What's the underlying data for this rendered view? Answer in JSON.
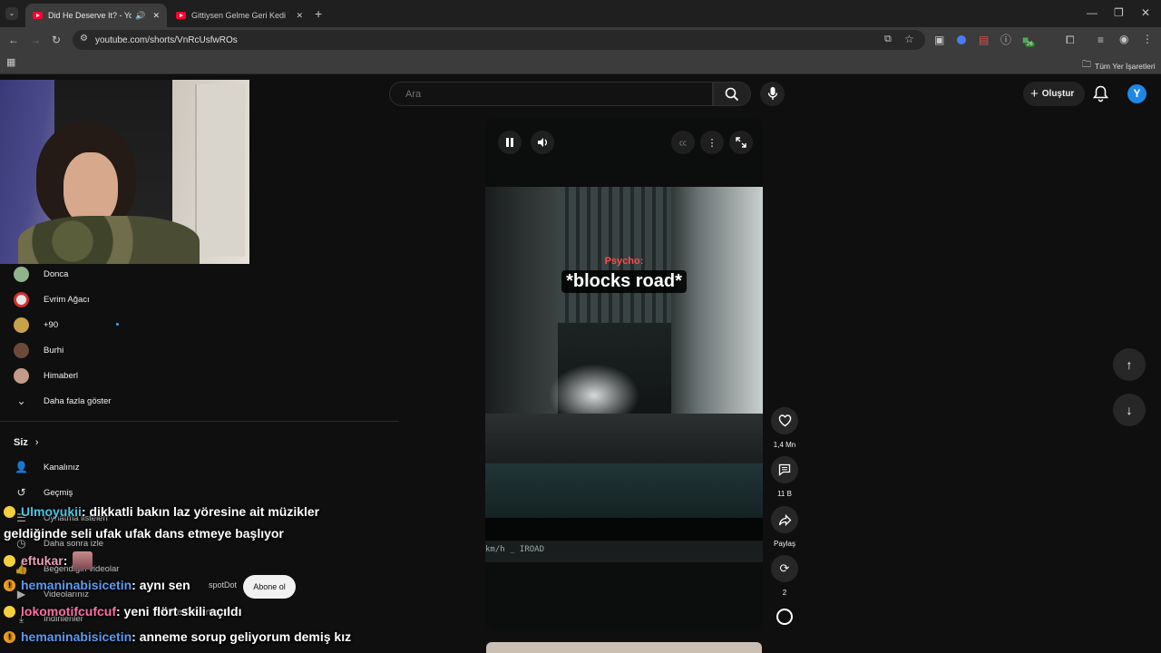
{
  "browser": {
    "tabs": [
      {
        "title": "Did He Deserve It? - YouTube",
        "active": true
      },
      {
        "title": "Gittiysen Gelme Geri Kedi Versiyon",
        "active": false
      }
    ],
    "url": "youtube.com/shorts/VnRcUsfwROs",
    "extension_badge": "26",
    "bookmarks_folder": "Tüm Yer İşaretleri"
  },
  "youtube": {
    "search_placeholder": "Ara",
    "create_label": "Oluştur",
    "avatar_letter": "Y",
    "sidebar": {
      "subscriptions": [
        {
          "name": "Donca",
          "color": "#8fb38a"
        },
        {
          "name": "Evrim Ağacı",
          "color": "#e6e6e6"
        },
        {
          "name": "+90",
          "color": "#c8a24a"
        },
        {
          "name": "Burhi",
          "color": "#6b4a3a"
        },
        {
          "name": "Himaberl",
          "color": "#c49a88"
        }
      ],
      "show_more": "Daha fazla göster",
      "you_section": "Siz",
      "you_items": [
        {
          "label": "Kanalınız",
          "icon": "person-icon"
        },
        {
          "label": "Geçmiş",
          "icon": "history-icon"
        },
        {
          "label": "Oynatma listeleri",
          "icon": "playlist-icon"
        },
        {
          "label": "Daha sonra izle",
          "icon": "clock-icon"
        },
        {
          "label": "Beğendiğin videolar",
          "icon": "like-icon"
        },
        {
          "label": "Videolarınız",
          "icon": "video-icon"
        },
        {
          "label": "İndirilenler",
          "icon": "download-icon"
        }
      ]
    },
    "short": {
      "overlay_label": "Psycho:",
      "overlay_caption": "*blocks road*",
      "dashcam_text": "km/h _ IROAD",
      "channel_partial": "spotDot",
      "subscribe_label": "Abone ol",
      "title_partial": "Did He Deserve It?",
      "actions": {
        "likes": "1,4 Mn",
        "comments": "11 B",
        "share": "Paylaş",
        "remix": "2"
      }
    }
  },
  "chat": [
    {
      "user": "Ulmoyukii",
      "color": "#49c6e5",
      "message": " : dikkatli bakın laz yöresine ait müzikler"
    },
    {
      "user": "",
      "color": "#ffffff",
      "message": "geldiğinde seli ufak ufak dans etmeye başlıyor"
    },
    {
      "user": "eftukar",
      "color": "#e8a0b4",
      "message": " :"
    },
    {
      "user": "hemaninabisicetin",
      "color": "#5b9bf0",
      "message": " : aynı sen"
    },
    {
      "user": "lokomotifcufcuf",
      "color": "#ff6fa8",
      "message": " : yeni flört skili açıldı"
    },
    {
      "user": "hemaninabisicetin",
      "color": "#5b9bf0",
      "message": " : anneme sorup geliyorum demiş kız"
    }
  ]
}
